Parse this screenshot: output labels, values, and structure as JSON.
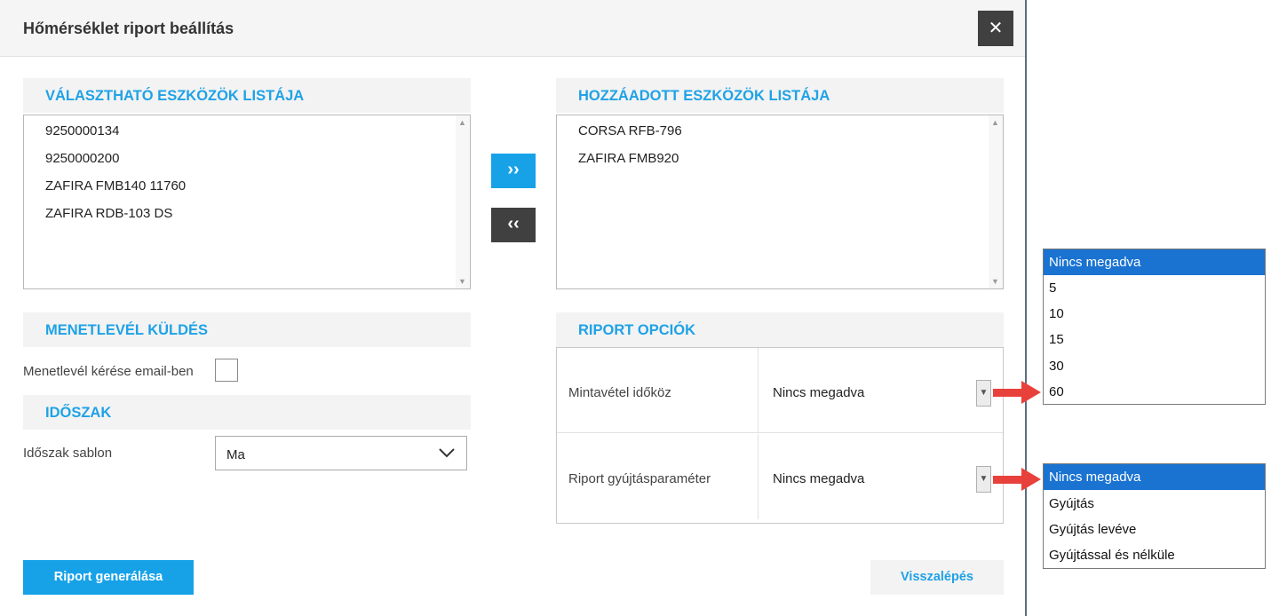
{
  "dialog": {
    "title": "Hőmérséklet riport beállítás",
    "close_glyph": "✕"
  },
  "available": {
    "heading": "VÁLASZTHATÓ ESZKÖZÖK LISTÁJA",
    "items": [
      "9250000134",
      "9250000200",
      "ZAFIRA FMB140 11760",
      "ZAFIRA RDB-103 DS"
    ]
  },
  "added": {
    "heading": "HOZZÁADOTT ESZKÖZÖK LISTÁJA",
    "items": [
      "CORSA RFB-796",
      "ZAFIRA FMB920"
    ]
  },
  "move_buttons": {
    "add_glyph": "››",
    "remove_glyph": "‹‹"
  },
  "waybill": {
    "heading": "MENETLEVÉL KÜLDÉS",
    "email_label": "Menetlevél kérése email-ben",
    "email_checked": false
  },
  "period": {
    "heading": "IDŐSZAK",
    "template_label": "Időszak sablon",
    "template_value": "Ma"
  },
  "report_options": {
    "heading": "RIPORT OPCIÓK",
    "rows": [
      {
        "label": "Mintavétel időköz",
        "value": "Nincs megadva"
      },
      {
        "label": "Riport gyújtásparaméter",
        "value": "Nincs megadva"
      }
    ]
  },
  "buttons": {
    "generate": "Riport generálása",
    "back": "Visszalépés"
  },
  "dropdown_interval": {
    "options": [
      "Nincs megadva",
      "5",
      "10",
      "15",
      "30",
      "60"
    ],
    "selected": "Nincs megadva"
  },
  "dropdown_ignition": {
    "options": [
      "Nincs megadva",
      "Gyújtás",
      "Gyújtás levéve",
      "Gyújtással és nélküle"
    ],
    "selected": "Nincs megadva"
  },
  "colors": {
    "accent_blue": "#17a2e8",
    "dark_button": "#404040",
    "selection_blue": "#1a73d1",
    "annotation_red": "#e8413b"
  }
}
